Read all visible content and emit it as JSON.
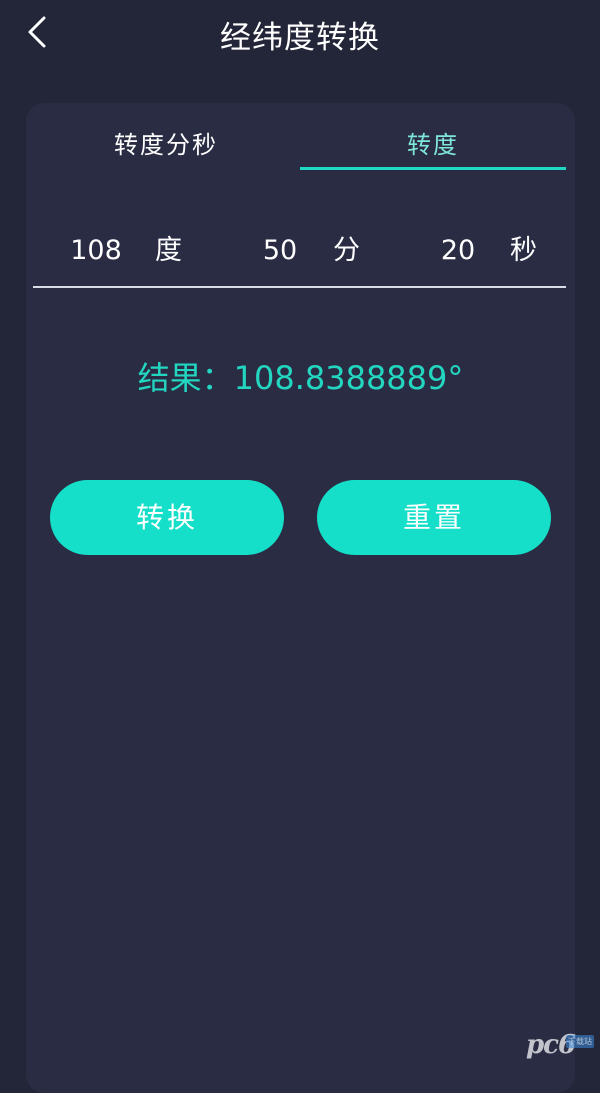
{
  "header": {
    "title": "经纬度转换",
    "back_icon": "chevron-left-icon"
  },
  "tabs": [
    {
      "label": "转度分秒",
      "active": false
    },
    {
      "label": "转度",
      "active": true
    }
  ],
  "inputs": {
    "degree_value": "108",
    "degree_unit": "度",
    "minute_value": "50",
    "minute_unit": "分",
    "second_value": "20",
    "second_unit": "秒"
  },
  "result": {
    "text": "结果：108.8388889°"
  },
  "buttons": {
    "convert_label": "转换",
    "reset_label": "重置"
  },
  "watermark": {
    "text": "pc6",
    "sub": "下载站"
  },
  "colors": {
    "background": "#232538",
    "card": "#2a2c44",
    "accent": "#15dfc8",
    "result_text": "#22d6c0",
    "active_tab_text": "#7fe7d9"
  }
}
